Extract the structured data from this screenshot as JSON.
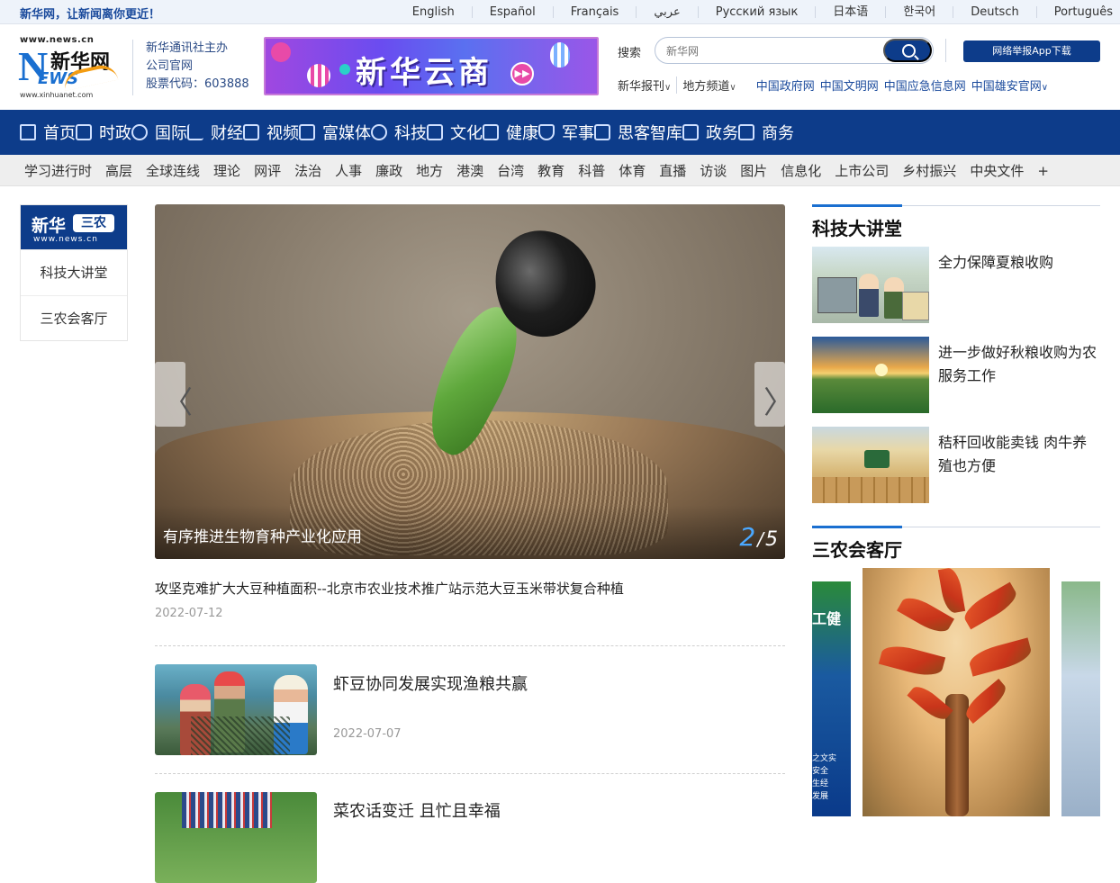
{
  "topbar": {
    "slogan": "新华网，让新闻离你更近！",
    "languages": [
      "English",
      "Español",
      "Français",
      "عربي",
      "Русский язык",
      "日本语",
      "한국어",
      "Deutsch",
      "Português"
    ]
  },
  "header": {
    "logo": {
      "url_top": "www.news.cn",
      "letter": "N",
      "ews": "EWS",
      "cn_name": "新华网",
      "url_bottom": "www.xinhuanet.com"
    },
    "org_info": [
      "新华通讯社主办",
      "公司官网",
      "股票代码：603888"
    ],
    "banner_text": "新华云商",
    "search": {
      "label": "搜索",
      "placeholder": "新华网"
    },
    "report_button": "网络举报App下载",
    "dropdowns": [
      "新华报刊",
      "地方频道"
    ],
    "portals": [
      "中国政府网",
      "中国文明网",
      "中国应急信息网",
      "中国雄安官网"
    ]
  },
  "mainnav": [
    "首页",
    "时政",
    "国际",
    "财经",
    "视频",
    "富媒体",
    "科技",
    "文化",
    "健康",
    "军事",
    "思客智库",
    "政务",
    "商务"
  ],
  "subnav": [
    "学习进行时",
    "高层",
    "全球连线",
    "理论",
    "网评",
    "法治",
    "人事",
    "廉政",
    "地方",
    "港澳",
    "台湾",
    "教育",
    "科普",
    "体育",
    "直播",
    "访谈",
    "图片",
    "信息化",
    "上市公司",
    "乡村振兴",
    "中央文件",
    "+"
  ],
  "sidecard": {
    "brand": {
      "name": "新华",
      "tag": "三农",
      "url": "www.news.cn"
    },
    "tabs": [
      "科技大讲堂",
      "三农会客厅"
    ]
  },
  "slider": {
    "caption": "有序推进生物育种产业化应用",
    "current": "2",
    "separator": "/",
    "total": "5",
    "prev": "〈",
    "next": "〉"
  },
  "articles": {
    "lead": {
      "title": "攻坚克难扩大大豆种植面积--北京市农业技术推广站示范大豆玉米带状复合种植",
      "date": "2022-07-12"
    },
    "items": [
      {
        "title": "虾豆协同发展实现渔粮共赢",
        "date": "2022-07-07"
      },
      {
        "title": "菜农话变迁 且忙且幸福"
      }
    ]
  },
  "right": {
    "section1": {
      "title": "科技大讲堂",
      "items": [
        {
          "title": "全力保障夏粮收购"
        },
        {
          "title": "进一步做好秋粮收购为农服务工作"
        },
        {
          "title": "秸秆回收能卖钱 肉牛养殖也方便"
        }
      ]
    },
    "section2": {
      "title": "三农会客厅",
      "gallery_left_text": "工健",
      "gallery_left_small": "之文实\n安全\n生经\n发展"
    }
  }
}
